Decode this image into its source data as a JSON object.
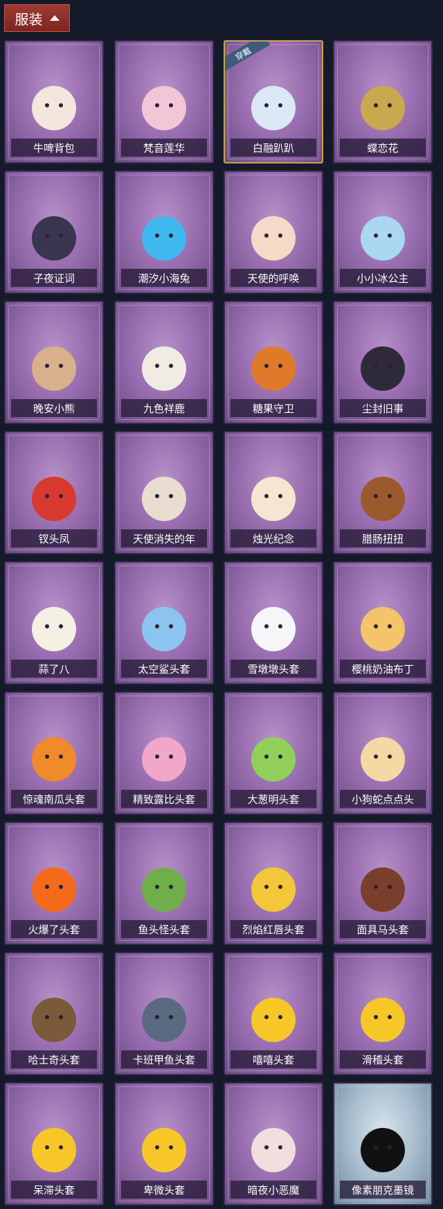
{
  "header": {
    "label": "服装",
    "arrow_icon": "chevron-up-icon"
  },
  "items": [
    {
      "name": "牛啤背包",
      "icon": "cow-beer-barrel-icon",
      "color": "#f3e6dc"
    },
    {
      "name": "梵音莲华",
      "icon": "lotus-girl-icon",
      "color": "#f2c6d6"
    },
    {
      "name": "白融趴趴",
      "icon": "white-seal-icon",
      "color": "#dbe8f5",
      "badge": "穿戴"
    },
    {
      "name": "蝶恋花",
      "icon": "butterfly-wreath-icon",
      "color": "#c9a84f"
    },
    {
      "name": "子夜证词",
      "icon": "crow-doll-icon",
      "color": "#3a3550"
    },
    {
      "name": "潮汐小海兔",
      "icon": "sea-rabbit-icon",
      "color": "#3fb8f0"
    },
    {
      "name": "天使的呼唤",
      "icon": "angel-girl-icon",
      "color": "#f7d9c8"
    },
    {
      "name": "小小冰公主",
      "icon": "ice-princess-icon",
      "color": "#a9d8f0"
    },
    {
      "name": "晚安小熊",
      "icon": "bear-charm-icon",
      "color": "#d9b08c"
    },
    {
      "name": "九色祥鹿",
      "icon": "deer-charm-icon",
      "color": "#f0ece4"
    },
    {
      "name": "糖果守卫",
      "icon": "pumpkin-scarecrow-icon",
      "color": "#e07a2b"
    },
    {
      "name": "尘封旧事",
      "icon": "dark-boy-icon",
      "color": "#2f2a3a"
    },
    {
      "name": "钗头凤",
      "icon": "phoenix-crown-icon",
      "color": "#d83a2f"
    },
    {
      "name": "天使消失的年",
      "icon": "angel-charm-icon",
      "color": "#e8ddd0"
    },
    {
      "name": "烛光纪念",
      "icon": "candle-icon",
      "color": "#f5e6cf"
    },
    {
      "name": "腊肠扭扭",
      "icon": "dachshund-icon",
      "color": "#9a5a2e"
    },
    {
      "name": "蒜了八",
      "icon": "garlic-head-icon",
      "color": "#f4f0e4"
    },
    {
      "name": "太空鲨头套",
      "icon": "shark-head-icon",
      "color": "#8cc4f0"
    },
    {
      "name": "雪墩墩头套",
      "icon": "snowman-head-icon",
      "color": "#f6f6f8"
    },
    {
      "name": "樱桃奶油布丁",
      "icon": "pudding-head-icon",
      "color": "#f3c46a"
    },
    {
      "name": "惊魂南瓜头套",
      "icon": "pumpkin-head-icon",
      "color": "#f08a2a"
    },
    {
      "name": "精致露比头套",
      "icon": "pink-beaver-head-icon",
      "color": "#f2a6c8"
    },
    {
      "name": "大葱明头套",
      "icon": "scallion-head-icon",
      "color": "#8fcf5a"
    },
    {
      "name": "小狗蛇点点头",
      "icon": "snake-dog-head-icon",
      "color": "#f3d9a4"
    },
    {
      "name": "火爆了头套",
      "icon": "fire-head-icon",
      "color": "#f46a1a"
    },
    {
      "name": "鱼头怪头套",
      "icon": "fish-head-icon",
      "color": "#6fae4a"
    },
    {
      "name": "烈焰红唇头套",
      "icon": "yellow-mouse-head-icon",
      "color": "#f2c83a"
    },
    {
      "name": "面具马头套",
      "icon": "horse-head-icon",
      "color": "#7a3f2a"
    },
    {
      "name": "哈士奇头套",
      "icon": "husky-head-icon",
      "color": "#7a5a3a"
    },
    {
      "name": "卡班甲鱼头套",
      "icon": "turtle-head-icon",
      "color": "#5a6a80"
    },
    {
      "name": "嘻嘻头套",
      "icon": "grin-emoji-icon",
      "color": "#f7c72a"
    },
    {
      "name": "滑稽头套",
      "icon": "funny-emoji-icon",
      "color": "#f7c72a"
    },
    {
      "name": "呆滞头套",
      "icon": "dazed-emoji-icon",
      "color": "#f7c72a"
    },
    {
      "name": "卑微头套",
      "icon": "humble-emoji-icon",
      "color": "#f7c72a"
    },
    {
      "name": "暗夜小恶魔",
      "icon": "devil-head-icon",
      "color": "#f1dede"
    },
    {
      "name": "像素朋克墨镜",
      "icon": "pixel-sunglasses-icon",
      "color": "#111111",
      "theme": "blue"
    }
  ]
}
